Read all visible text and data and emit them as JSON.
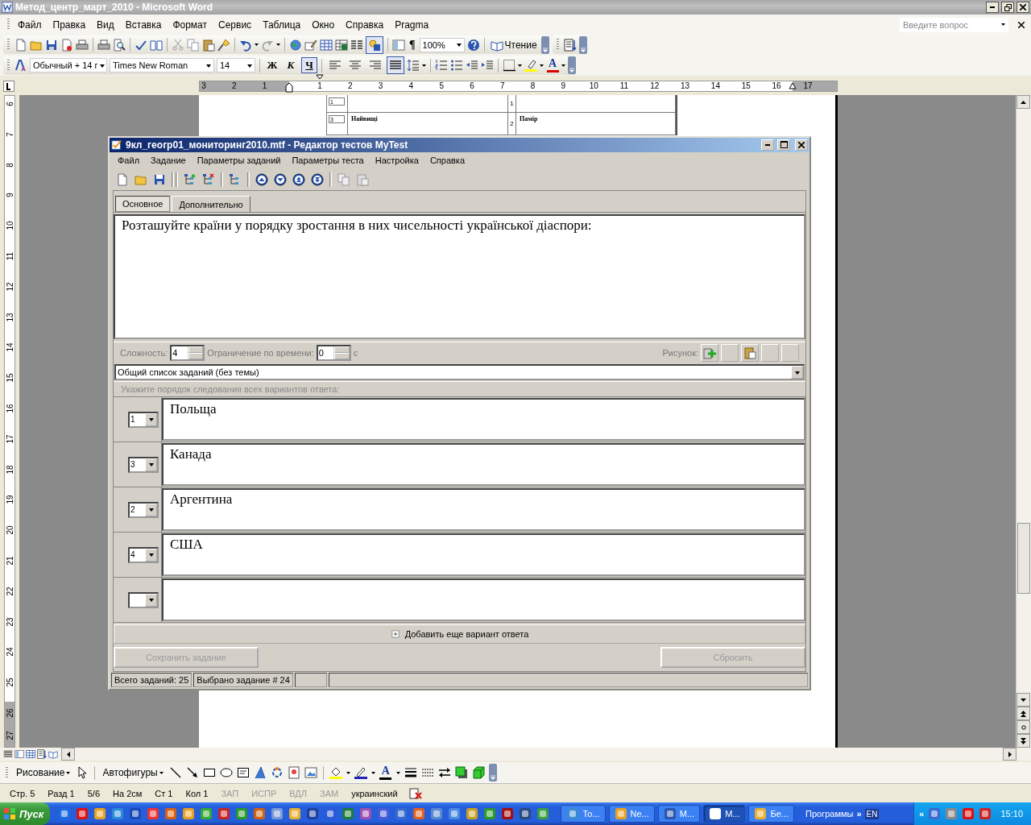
{
  "word_window": {
    "title": "Метод_центр_март_2010 - Microsoft Word"
  },
  "menu": [
    "Файл",
    "Правка",
    "Вид",
    "Вставка",
    "Формат",
    "Сервис",
    "Таблица",
    "Окно",
    "Справка",
    "Pragma"
  ],
  "help_search": {
    "placeholder": "Введите вопрос"
  },
  "standard_toolbar": {
    "show_marks": "¶",
    "zoom": "100%",
    "reading_button": "Чтение",
    "drawing_selected": true
  },
  "formatting_toolbar": {
    "style": "Обычный + 14 г",
    "font": "Times New Roman",
    "size": "14",
    "text_styles": [
      {
        "kind": "bold",
        "label": "Ж",
        "selected": false
      },
      {
        "kind": "italic",
        "label": "К",
        "selected": false
      },
      {
        "kind": "underline",
        "label": "Ч",
        "selected": true
      }
    ],
    "alignment": [
      {
        "kind": "left",
        "selected": false
      },
      {
        "kind": "center",
        "selected": false
      },
      {
        "kind": "right",
        "selected": false
      },
      {
        "kind": "justify",
        "selected": true
      }
    ],
    "font_color": "A"
  },
  "horizontal_ruler": {
    "left_margin_labels": [
      "3",
      "2",
      "1"
    ],
    "labels": [
      "1",
      "2",
      "3",
      "4",
      "5",
      "6",
      "7",
      "8",
      "9",
      "10",
      "11",
      "12",
      "13",
      "14",
      "15",
      "16"
    ],
    "right_margin_labels": [
      "17"
    ]
  },
  "vertical_ruler": {
    "labels": [
      "6",
      "7",
      "8",
      "9",
      "10",
      "11",
      "12",
      "13",
      "14",
      "15",
      "16",
      "17",
      "18",
      "19",
      "20",
      "21",
      "22",
      "23",
      "24",
      "25"
    ],
    "bottom_margin_labels": [
      "26",
      "27"
    ]
  },
  "document_table": {
    "rows": [
      {
        "order": "1",
        "number": "1"
      },
      {
        "order": "3",
        "left_text": "Найвищі",
        "number": "2",
        "right_text": "Памір"
      }
    ]
  },
  "dialog": {
    "title": "9кл_геогр01_мониторинг2010.mtf - Редактор тестов MyTest",
    "menu": [
      "Файл",
      "Задание",
      "Параметры заданий",
      "Параметры теста",
      "Настройка",
      "Справка"
    ],
    "tabs": [
      {
        "label": "Основное",
        "selected": true
      },
      {
        "label": "Дополнительно",
        "selected": false
      }
    ],
    "question": "Розташуйте країни у порядку зростання в них чисельності української діаспори:",
    "difficulty_label": "Сложность:",
    "difficulty": "4",
    "time_limit_label": "Ограничение по времени:",
    "time_limit": "0",
    "time_unit": "с",
    "picture_label": "Рисунок:",
    "topic": "Общий список заданий (без темы)",
    "instruction": "Укажите порядок следования всех вариантов ответа:",
    "answers": [
      {
        "kind": "filled",
        "order": "1",
        "text": "Польща"
      },
      {
        "kind": "filled",
        "order": "3",
        "text": "Канада"
      },
      {
        "kind": "filled",
        "order": "2",
        "text": "Аргентина"
      },
      {
        "kind": "filled",
        "order": "4",
        "text": "США"
      },
      {
        "kind": "blank"
      }
    ],
    "add_answer_button": "Добавить еще вариант ответа",
    "save_button": {
      "label": "Сохранить задание",
      "disabled": true
    },
    "reset_button": {
      "label": "Сбросить",
      "disabled": true
    },
    "status": [
      "Всего заданий: 25",
      "Выбрано задание # 24"
    ]
  },
  "drawing_toolbar": {
    "draw_menu": "Рисование",
    "autoshapes_menu": "Автофигуры",
    "font_color": "A"
  },
  "status_bar": [
    {
      "text": "Стр. 5",
      "disabled": false
    },
    {
      "text": "Разд 1",
      "disabled": false
    },
    {
      "text": "5/6",
      "disabled": false
    },
    {
      "text": "На 2см",
      "disabled": false
    },
    {
      "text": "Ст 1",
      "disabled": false
    },
    {
      "text": "Кол 1",
      "disabled": false
    },
    {
      "text": "ЗАП",
      "disabled": true
    },
    {
      "text": "ИСПР",
      "disabled": true
    },
    {
      "text": "ВДЛ",
      "disabled": true
    },
    {
      "text": "ЗАМ",
      "disabled": true
    },
    {
      "text": "украинский",
      "disabled": false
    }
  ],
  "taskbar": {
    "start": "Пуск",
    "tasks": [
      {
        "label": "То...",
        "selected": false
      },
      {
        "label": "Ne...",
        "selected": false
      },
      {
        "label": "М...",
        "selected": false
      },
      {
        "label": "М...",
        "selected": true
      },
      {
        "label": "Бе...",
        "selected": false
      }
    ],
    "toolbar_label": "Программы",
    "expand": "»",
    "language": "EN",
    "tray_expand": "«",
    "clock": "15:10"
  }
}
